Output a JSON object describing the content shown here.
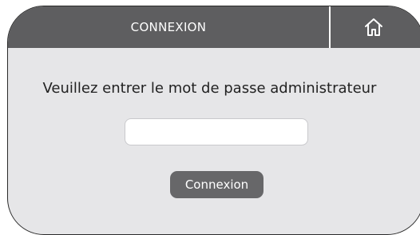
{
  "header": {
    "title": "CONNEXION",
    "home_icon": "home-icon"
  },
  "main": {
    "prompt": "Veuillez entrer le mot de passe administrateur",
    "password": {
      "value": "",
      "placeholder": ""
    },
    "login_button_label": "Connexion"
  },
  "colors": {
    "header_bg": "#5e5e60",
    "body_bg": "#e6e6e8",
    "button_bg": "#676769"
  }
}
